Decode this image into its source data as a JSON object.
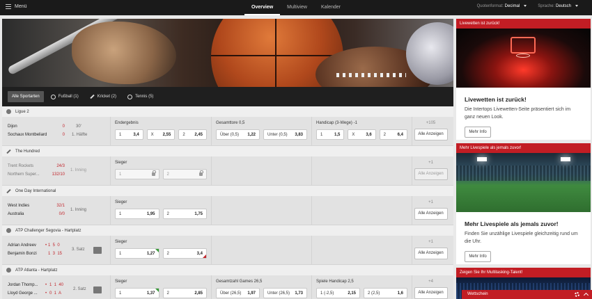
{
  "topbar": {
    "menu_label": "Menü",
    "nav": [
      "Overview",
      "Multiview",
      "Kalender"
    ],
    "odds_format_label": "Quotenformat:",
    "odds_format_value": "Decimal",
    "language_label": "Sprache:",
    "language_value": "Deutsch"
  },
  "tabs": [
    {
      "label": "Alle Sportarten",
      "icon": ""
    },
    {
      "label": "Fußball (1)",
      "icon": "soccer-ball-icon"
    },
    {
      "label": "Kricket (2)",
      "icon": "cricket-bat-icon"
    },
    {
      "label": "Tennis (5)",
      "icon": "tennis-ball-icon"
    }
  ],
  "events": [
    {
      "league": "Ligue 2",
      "league_icon": "soccer-ball-icon",
      "team1": "Dijon",
      "team2": "Sochaux Montbeliard",
      "score1": "0",
      "score2": "0",
      "status1": "30'",
      "status2": "1. Hälfte",
      "markets": [
        {
          "title": "Endergebnis",
          "odds": [
            {
              "l": "1",
              "v": "3,4"
            },
            {
              "l": "X",
              "v": "2,55"
            },
            {
              "l": "2",
              "v": "2,45"
            }
          ]
        },
        {
          "title": "Gesamttore 0,5",
          "odds": [
            {
              "l": "Über (0,5)",
              "v": "1,22"
            },
            {
              "l": "Unter (0,5)",
              "v": "3,83"
            }
          ]
        },
        {
          "title": "Handicap (3-Wege) -1",
          "odds": [
            {
              "l": "1",
              "v": "1,5"
            },
            {
              "l": "X",
              "v": "3,6"
            },
            {
              "l": "2",
              "v": "6,4"
            }
          ]
        }
      ],
      "more": "+105",
      "button": "Alle Anzeigen"
    },
    {
      "league": "The Hundred",
      "league_icon": "cricket-bat-icon",
      "team1": "Trent Rockets",
      "team2": "Northern Super...",
      "score1": "24/3",
      "score2": "132/10",
      "status1": "1. Inning",
      "markets": [
        {
          "title": "Sieger",
          "odds": [
            {
              "l": "1",
              "v": ""
            },
            {
              "l": "2",
              "v": ""
            }
          ]
        }
      ],
      "more": "+1",
      "button": "Alle Anzeigen"
    },
    {
      "league": "One Day International",
      "league_icon": "cricket-bat-icon",
      "team1": "West Indies",
      "team2": "Australia",
      "score1": "32/1",
      "score2": "0/0",
      "status1": "1. Inning",
      "markets": [
        {
          "title": "Sieger",
          "odds": [
            {
              "l": "1",
              "v": "1,95"
            },
            {
              "l": "2",
              "v": "1,75"
            }
          ]
        }
      ],
      "more": "+1",
      "button": "Alle Anzeigen"
    },
    {
      "league": "ATP Challenger Segovia - Hartplatz",
      "league_icon": "tennis-ball-icon",
      "team1": "Adrian Andreev",
      "team2": "Benjamin Bonzi",
      "score1": "1  5  0",
      "score2": "1  3  15",
      "status1": "3. Satz",
      "markets": [
        {
          "title": "Sieger",
          "odds": [
            {
              "l": "1",
              "v": "1,27"
            },
            {
              "l": "2",
              "v": "3,4"
            }
          ]
        }
      ],
      "more": "+1",
      "button": "Alle Anzeigen"
    },
    {
      "league": "ATP Atlanta - Hartplatz",
      "league_icon": "tennis-ball-icon",
      "team1": "Jordan Thomp...",
      "team2": "Lloyd George ...",
      "score1": "1  1  40",
      "score2": "0  1  A",
      "status1": "2. Satz",
      "markets": [
        {
          "title": "Sieger",
          "odds": [
            {
              "l": "1",
              "v": "1,37"
            },
            {
              "l": "2",
              "v": "2,85"
            }
          ]
        },
        {
          "title": "Gesamtzahl Games 26,5",
          "odds": [
            {
              "l": "Über (26,5)",
              "v": "1,97"
            },
            {
              "l": "Unter (26,5)",
              "v": "1,73"
            }
          ]
        },
        {
          "title": "Spiele Handicap 2,5",
          "odds": [
            {
              "l": "1 (-2,5)",
              "v": "2,15"
            },
            {
              "l": "2 (2,5)",
              "v": "1,6"
            }
          ]
        }
      ],
      "more": "+4",
      "button": "Alle Anzeigen"
    }
  ],
  "promos": [
    {
      "header": "Livewetten ist zurück!",
      "title": "Livewetten ist zurück!",
      "text": "Die Intertops Livewetten-Seite präsentiert sich im ganz neuen Look.",
      "button": "Mehr Info"
    },
    {
      "header": "Mehr Livespiele als jemals zuvor!",
      "title": "Mehr Livespiele als jemals zuvor!",
      "text": "Finden Sie unzählige Livespiele gleichzeitig rund um die Uhr.",
      "button": "Mehr Info"
    },
    {
      "header": "Zeigen Sie Ihr Multitasking-Talent!"
    }
  ],
  "betslip": {
    "label": "Wettschein"
  },
  "colors": {
    "accent": "#c21d24",
    "odds_up": "#3a9b3a",
    "odds_down": "#c2272d"
  }
}
